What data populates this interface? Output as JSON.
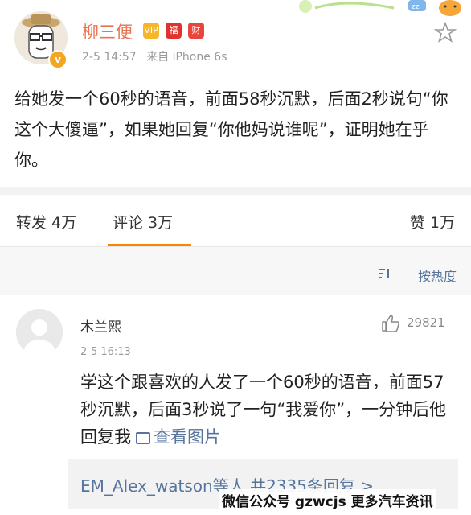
{
  "post": {
    "username": "柳三便",
    "badges": [
      {
        "icon": "vip-crown-icon",
        "text": "VIP",
        "color": "#f5b62c"
      },
      {
        "icon": "red-envelope-icon",
        "text": "福",
        "color": "#e0332f"
      },
      {
        "icon": "wealth-badge-icon",
        "text": "财",
        "color": "#e8453c"
      }
    ],
    "timestamp": "2-5 14:57",
    "source": "来自 iPhone 6s",
    "text": "给她发一个60秒的语音，前面58秒沉默，后面2秒说句“你这个大傻逼”，如果她回复“你他妈说谁呢”，证明她在乎你。"
  },
  "tabs": {
    "repost": "转发 4万",
    "comments": "评论 3万",
    "likes": "赞 1万"
  },
  "sort": {
    "label": "按热度"
  },
  "comment": {
    "name": "木兰熙",
    "time": "2-5 16:13",
    "likes": "29821",
    "text": "学这个跟喜欢的人发了一个60秒的语音，前面57秒沉默，后面3秒说了一句“我爱你”，一分钟后他回复我",
    "image_link": "查看图片",
    "replies": "EM_Alex_watson等人 共2335条回复",
    "replies_chevron": ">"
  },
  "watermark": "微信公众号 gzwcjs 更多汽车资讯",
  "colors": {
    "accent": "#ff8200",
    "link": "#57759c",
    "username": "#eb7350"
  }
}
